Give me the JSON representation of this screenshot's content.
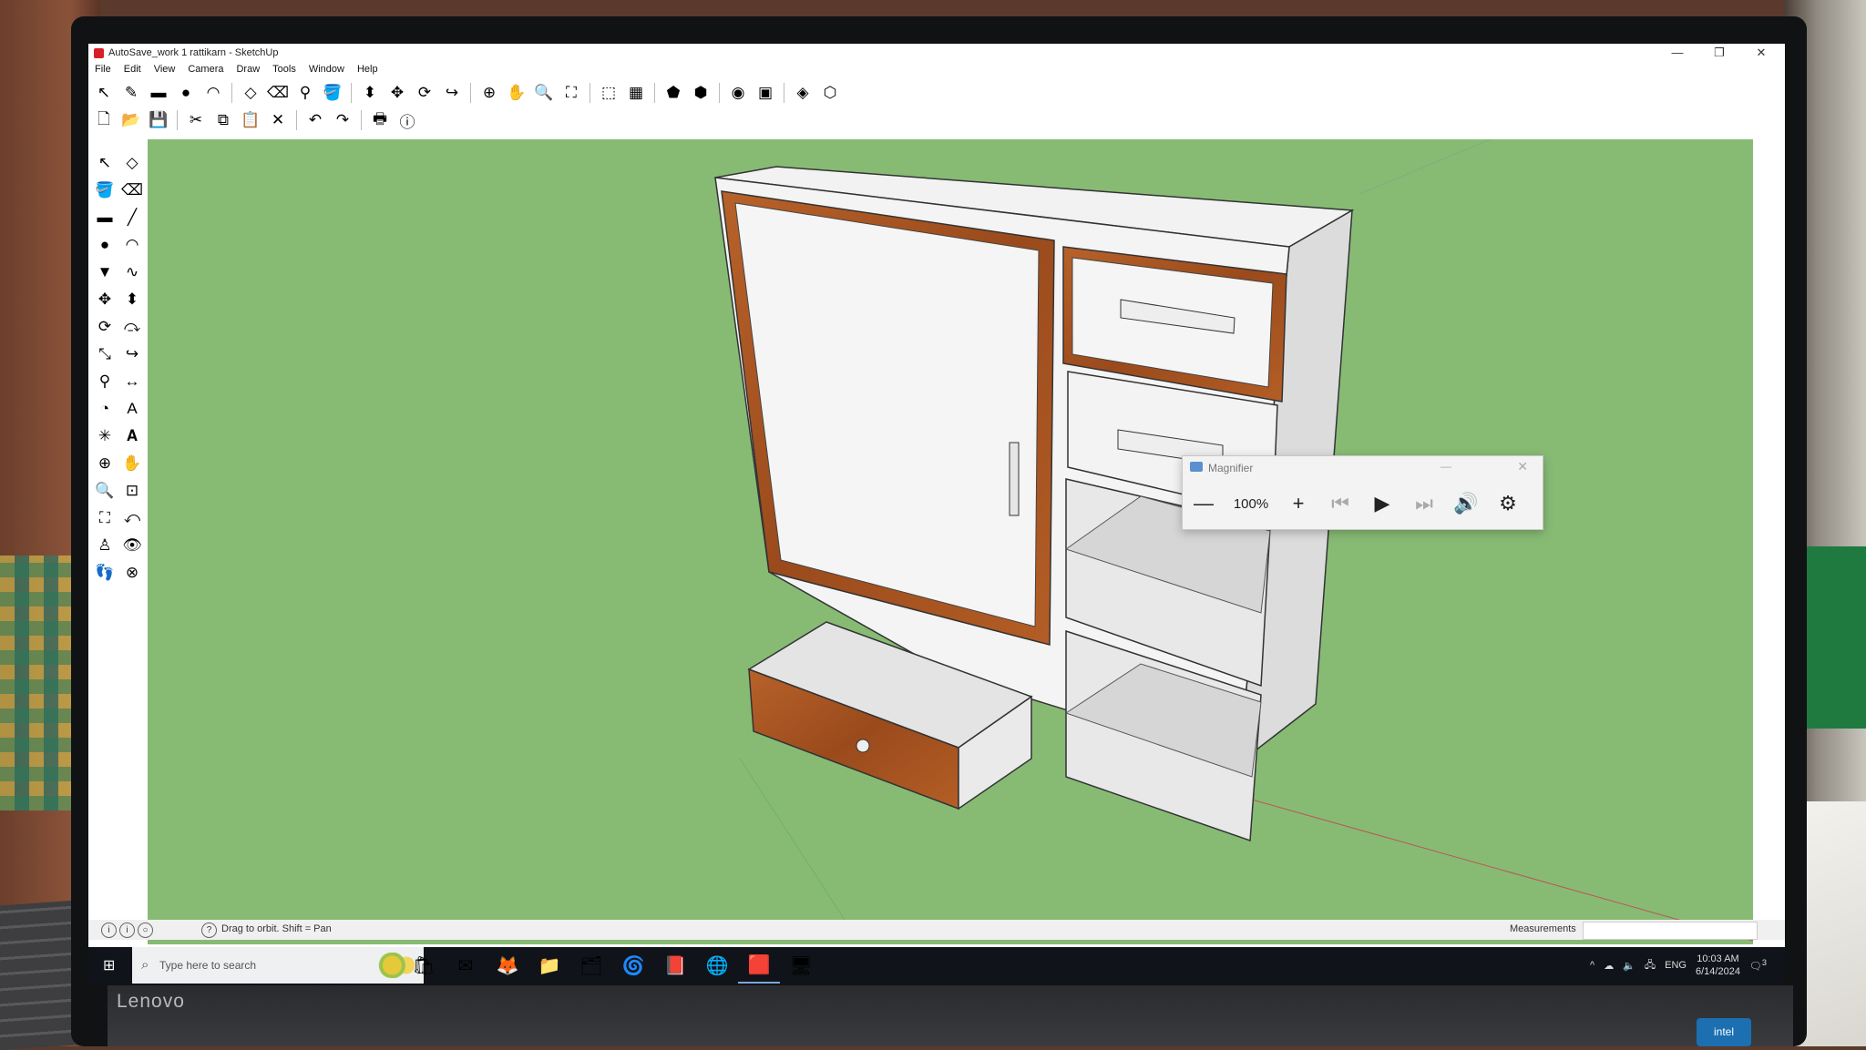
{
  "window": {
    "title": "AutoSave_work 1 rattikarn - SketchUp",
    "controls": [
      "—",
      "❐",
      "✕"
    ]
  },
  "menu": [
    "File",
    "Edit",
    "View",
    "Camera",
    "Draw",
    "Tools",
    "Window",
    "Help"
  ],
  "toolbar_row1": [
    {
      "name": "select-icon",
      "glyph": "↖"
    },
    {
      "name": "pencil-icon",
      "glyph": "✎"
    },
    {
      "name": "rectangle-icon",
      "glyph": "▬"
    },
    {
      "name": "circle-icon",
      "glyph": "●"
    },
    {
      "name": "arc-icon",
      "glyph": "◠"
    },
    {
      "name": "component-icon",
      "glyph": "◇"
    },
    {
      "name": "eraser-icon",
      "glyph": "⌫"
    },
    {
      "name": "tape-measure-icon",
      "glyph": "⚲"
    },
    {
      "name": "paint-bucket-icon",
      "glyph": "🪣"
    },
    {
      "name": "push-pull-icon",
      "glyph": "⬍"
    },
    {
      "name": "move-icon",
      "glyph": "✥"
    },
    {
      "name": "rotate-icon",
      "glyph": "⟳"
    },
    {
      "name": "offset-icon",
      "glyph": "↪"
    },
    {
      "name": "orbit-icon",
      "glyph": "⊕"
    },
    {
      "name": "pan-icon",
      "glyph": "✋"
    },
    {
      "name": "zoom-icon",
      "glyph": "🔍"
    },
    {
      "name": "zoom-extents-icon",
      "glyph": "⛶"
    },
    {
      "name": "warehouse-icon",
      "glyph": "⬚"
    },
    {
      "name": "extension-icon",
      "glyph": "▦"
    },
    {
      "name": "geo-location-icon",
      "glyph": "⬟"
    },
    {
      "name": "add-location-icon",
      "glyph": "⬢"
    },
    {
      "name": "photo-texture-icon",
      "glyph": "◉"
    },
    {
      "name": "layout-icon",
      "glyph": "▣"
    },
    {
      "name": "style-builder-icon",
      "glyph": "◈"
    },
    {
      "name": "send-to-layout-icon",
      "glyph": "⬡"
    }
  ],
  "toolbar_row2": [
    {
      "name": "new-icon",
      "glyph": "🗋"
    },
    {
      "name": "open-icon",
      "glyph": "📂"
    },
    {
      "name": "save-icon",
      "glyph": "💾"
    },
    {
      "name": "cut-icon",
      "glyph": "✂"
    },
    {
      "name": "copy-icon",
      "glyph": "⧉"
    },
    {
      "name": "paste-icon",
      "glyph": "📋"
    },
    {
      "name": "delete-icon",
      "glyph": "✕"
    },
    {
      "name": "undo-icon",
      "glyph": "↶"
    },
    {
      "name": "redo-icon",
      "glyph": "↷"
    },
    {
      "name": "print-icon",
      "glyph": "🖶"
    },
    {
      "name": "model-info-icon",
      "glyph": "ⓘ"
    }
  ],
  "left_tools": [
    {
      "name": "select-icon",
      "glyph": "↖"
    },
    {
      "name": "make-component-icon",
      "glyph": "◇"
    },
    {
      "name": "paint-bucket-icon",
      "glyph": "🪣"
    },
    {
      "name": "eraser-icon",
      "glyph": "⌫"
    },
    {
      "name": "rectangle-icon",
      "glyph": "▬"
    },
    {
      "name": "line-icon",
      "glyph": "╱"
    },
    {
      "name": "circle-icon",
      "glyph": "●"
    },
    {
      "name": "arc-icon",
      "glyph": "◠"
    },
    {
      "name": "polygon-icon",
      "glyph": "▼"
    },
    {
      "name": "freehand-icon",
      "glyph": "∿"
    },
    {
      "name": "move-icon",
      "glyph": "✥"
    },
    {
      "name": "push-pull-icon",
      "glyph": "⬍"
    },
    {
      "name": "rotate-icon",
      "glyph": "⟳"
    },
    {
      "name": "follow-me-icon",
      "glyph": "⤼"
    },
    {
      "name": "scale-icon",
      "glyph": "⤡"
    },
    {
      "name": "offset-icon",
      "glyph": "↪"
    },
    {
      "name": "tape-measure-icon",
      "glyph": "⚲"
    },
    {
      "name": "dimension-icon",
      "glyph": "↔"
    },
    {
      "name": "protractor-icon",
      "glyph": "◔"
    },
    {
      "name": "text-icon",
      "glyph": "A"
    },
    {
      "name": "axes-icon",
      "glyph": "✳"
    },
    {
      "name": "3d-text-icon",
      "glyph": "𝐀"
    },
    {
      "name": "orbit-icon",
      "glyph": "⊕"
    },
    {
      "name": "pan-icon",
      "glyph": "✋"
    },
    {
      "name": "zoom-icon",
      "glyph": "🔍"
    },
    {
      "name": "zoom-window-icon",
      "glyph": "⊡"
    },
    {
      "name": "zoom-extents-icon",
      "glyph": "⛶"
    },
    {
      "name": "previous-view-icon",
      "glyph": "⤺"
    },
    {
      "name": "position-camera-icon",
      "glyph": "♙"
    },
    {
      "name": "look-around-icon",
      "glyph": "👁"
    },
    {
      "name": "walk-icon",
      "glyph": "👣"
    },
    {
      "name": "section-plane-icon",
      "glyph": "⊗"
    }
  ],
  "magnifier": {
    "title": "Magnifier",
    "zoom": "100%",
    "minus": "—",
    "plus": "+",
    "prev": "⏮",
    "play": "▶",
    "next": "⏭",
    "read": "🔊",
    "settings": "⚙"
  },
  "statusbar": {
    "hint": "Drag to orbit.  Shift = Pan",
    "measurements_label": "Measurements",
    "help_icon": "?"
  },
  "taskbar": {
    "search_placeholder": "Type here to search",
    "apps": [
      {
        "name": "store-icon",
        "glyph": "🛍"
      },
      {
        "name": "mail-icon",
        "glyph": "✉"
      },
      {
        "name": "firefox-icon",
        "glyph": "🦊"
      },
      {
        "name": "file-explorer-icon",
        "glyph": "📁"
      },
      {
        "name": "files-icon",
        "glyph": "🗂"
      },
      {
        "name": "edge-icon",
        "glyph": "🌀"
      },
      {
        "name": "acrobat-icon",
        "glyph": "📕"
      },
      {
        "name": "chrome-icon",
        "glyph": "🌐"
      },
      {
        "name": "sketchup-icon",
        "glyph": "🟥"
      },
      {
        "name": "remote-desktop-icon",
        "glyph": "🖥"
      }
    ],
    "tray": {
      "lang": "ENG",
      "time": "10:03 AM",
      "date": "6/14/2024",
      "notification_count": "3"
    }
  },
  "brand": {
    "monitor": "Lenovo",
    "sticker": "intel"
  },
  "colors": {
    "viewport": "#87bb74",
    "wood": "#a5531f",
    "cabinet": "#ededed"
  }
}
